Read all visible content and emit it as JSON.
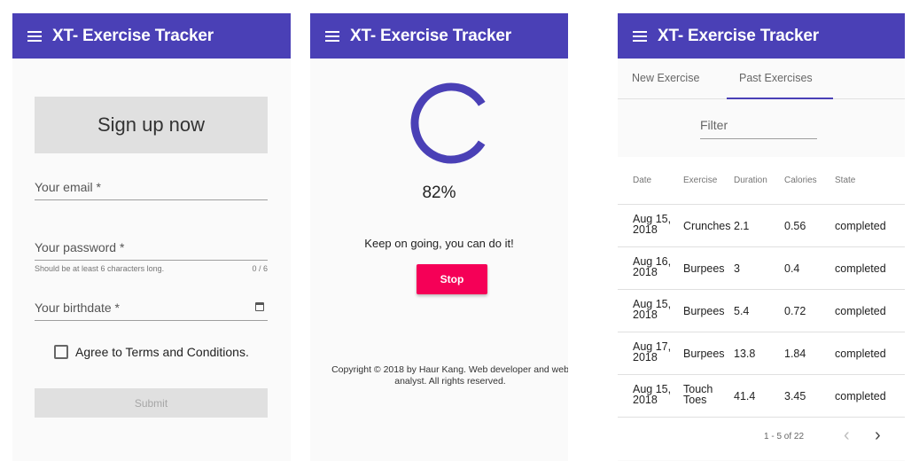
{
  "app_title": "XT- Exercise Tracker",
  "signup": {
    "heading": "Sign up now",
    "email_label": "Your email *",
    "password_label": "Your password *",
    "password_hint": "Should be at least 6 characters long.",
    "password_counter": "0 / 6",
    "birthdate_label": "Your birthdate *",
    "terms_label": "Agree to Terms and Conditions.",
    "submit_label": "Submit"
  },
  "training": {
    "progress_percent": 82,
    "progress_text": "82%",
    "message": "Keep on going, you can do it!",
    "stop_label": "Stop",
    "copyright": "Copyright © 2018 by Haur Kang. Web developer and web analyst. All rights reserved."
  },
  "past": {
    "tabs": [
      "New Exercise",
      "Past Exercises"
    ],
    "active_tab": 1,
    "filter_label": "Filter",
    "columns": [
      "Date",
      "Exercise",
      "Duration",
      "Calories",
      "State"
    ],
    "rows": [
      {
        "date1": "Aug 15,",
        "date2": "2018",
        "exercise1": "Crunches",
        "exercise2": "",
        "duration": "2.1",
        "calories": "0.56",
        "state": "completed"
      },
      {
        "date1": "Aug 16,",
        "date2": "2018",
        "exercise1": "Burpees",
        "exercise2": "",
        "duration": "3",
        "calories": "0.4",
        "state": "completed"
      },
      {
        "date1": "Aug 15,",
        "date2": "2018",
        "exercise1": "Burpees",
        "exercise2": "",
        "duration": "5.4",
        "calories": "0.72",
        "state": "completed"
      },
      {
        "date1": "Aug 17,",
        "date2": "2018",
        "exercise1": "Burpees",
        "exercise2": "",
        "duration": "13.8",
        "calories": "1.84",
        "state": "completed"
      },
      {
        "date1": "Aug 15,",
        "date2": "2018",
        "exercise1": "Touch",
        "exercise2": "Toes",
        "duration": "41.4",
        "calories": "3.45",
        "state": "completed"
      }
    ],
    "range": "1 - 5 of 22",
    "prev_icon": "‹",
    "next_icon": "›"
  },
  "colors": {
    "primary": "#4a40b6",
    "accent": "#f50057"
  }
}
